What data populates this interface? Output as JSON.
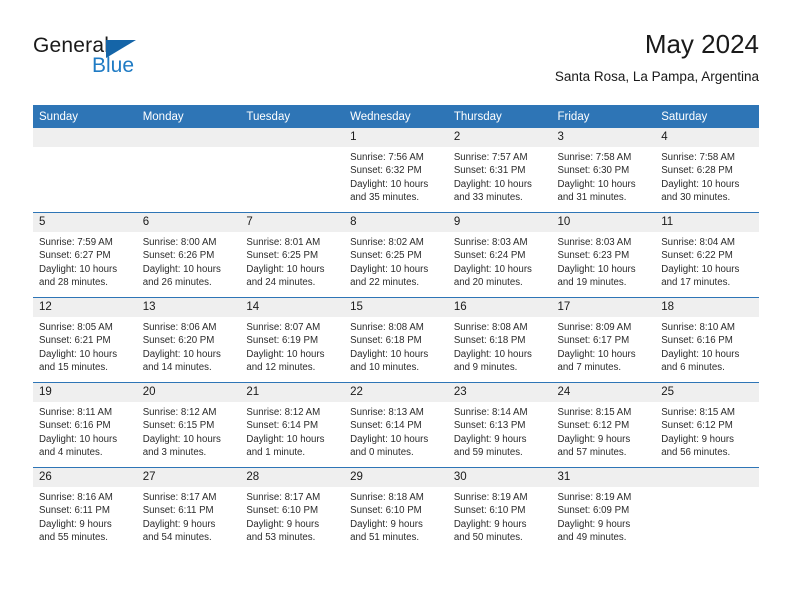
{
  "brand": {
    "name_top": "General",
    "name_bottom": "Blue",
    "color_dark": "#1a1a1a",
    "color_blue": "#1f7bc4",
    "triangle_color": "#1565a8"
  },
  "header": {
    "title": "May 2024",
    "subtitle": "Santa Rosa, La Pampa, Argentina"
  },
  "theme": {
    "header_bg": "#2e75b6",
    "header_text": "#ffffff",
    "daynum_bg": "#efefef",
    "row_divider": "#2e75b6",
    "cell_bg": "#ffffff"
  },
  "weekdays": [
    "Sunday",
    "Monday",
    "Tuesday",
    "Wednesday",
    "Thursday",
    "Friday",
    "Saturday"
  ],
  "labels": {
    "sunrise_prefix": "Sunrise:",
    "sunset_prefix": "Sunset:",
    "daylight_prefix": "Daylight:"
  },
  "weeks": [
    [
      {
        "day": "",
        "empty": true,
        "sunrise": "",
        "sunset": "",
        "daylight_1": "",
        "daylight_2": ""
      },
      {
        "day": "",
        "empty": true,
        "sunrise": "",
        "sunset": "",
        "daylight_1": "",
        "daylight_2": ""
      },
      {
        "day": "",
        "empty": true,
        "sunrise": "",
        "sunset": "",
        "daylight_1": "",
        "daylight_2": ""
      },
      {
        "day": "1",
        "empty": false,
        "sunrise": "Sunrise: 7:56 AM",
        "sunset": "Sunset: 6:32 PM",
        "daylight_1": "Daylight: 10 hours",
        "daylight_2": "and 35 minutes."
      },
      {
        "day": "2",
        "empty": false,
        "sunrise": "Sunrise: 7:57 AM",
        "sunset": "Sunset: 6:31 PM",
        "daylight_1": "Daylight: 10 hours",
        "daylight_2": "and 33 minutes."
      },
      {
        "day": "3",
        "empty": false,
        "sunrise": "Sunrise: 7:58 AM",
        "sunset": "Sunset: 6:30 PM",
        "daylight_1": "Daylight: 10 hours",
        "daylight_2": "and 31 minutes."
      },
      {
        "day": "4",
        "empty": false,
        "sunrise": "Sunrise: 7:58 AM",
        "sunset": "Sunset: 6:28 PM",
        "daylight_1": "Daylight: 10 hours",
        "daylight_2": "and 30 minutes."
      }
    ],
    [
      {
        "day": "5",
        "empty": false,
        "sunrise": "Sunrise: 7:59 AM",
        "sunset": "Sunset: 6:27 PM",
        "daylight_1": "Daylight: 10 hours",
        "daylight_2": "and 28 minutes."
      },
      {
        "day": "6",
        "empty": false,
        "sunrise": "Sunrise: 8:00 AM",
        "sunset": "Sunset: 6:26 PM",
        "daylight_1": "Daylight: 10 hours",
        "daylight_2": "and 26 minutes."
      },
      {
        "day": "7",
        "empty": false,
        "sunrise": "Sunrise: 8:01 AM",
        "sunset": "Sunset: 6:25 PM",
        "daylight_1": "Daylight: 10 hours",
        "daylight_2": "and 24 minutes."
      },
      {
        "day": "8",
        "empty": false,
        "sunrise": "Sunrise: 8:02 AM",
        "sunset": "Sunset: 6:25 PM",
        "daylight_1": "Daylight: 10 hours",
        "daylight_2": "and 22 minutes."
      },
      {
        "day": "9",
        "empty": false,
        "sunrise": "Sunrise: 8:03 AM",
        "sunset": "Sunset: 6:24 PM",
        "daylight_1": "Daylight: 10 hours",
        "daylight_2": "and 20 minutes."
      },
      {
        "day": "10",
        "empty": false,
        "sunrise": "Sunrise: 8:03 AM",
        "sunset": "Sunset: 6:23 PM",
        "daylight_1": "Daylight: 10 hours",
        "daylight_2": "and 19 minutes."
      },
      {
        "day": "11",
        "empty": false,
        "sunrise": "Sunrise: 8:04 AM",
        "sunset": "Sunset: 6:22 PM",
        "daylight_1": "Daylight: 10 hours",
        "daylight_2": "and 17 minutes."
      }
    ],
    [
      {
        "day": "12",
        "empty": false,
        "sunrise": "Sunrise: 8:05 AM",
        "sunset": "Sunset: 6:21 PM",
        "daylight_1": "Daylight: 10 hours",
        "daylight_2": "and 15 minutes."
      },
      {
        "day": "13",
        "empty": false,
        "sunrise": "Sunrise: 8:06 AM",
        "sunset": "Sunset: 6:20 PM",
        "daylight_1": "Daylight: 10 hours",
        "daylight_2": "and 14 minutes."
      },
      {
        "day": "14",
        "empty": false,
        "sunrise": "Sunrise: 8:07 AM",
        "sunset": "Sunset: 6:19 PM",
        "daylight_1": "Daylight: 10 hours",
        "daylight_2": "and 12 minutes."
      },
      {
        "day": "15",
        "empty": false,
        "sunrise": "Sunrise: 8:08 AM",
        "sunset": "Sunset: 6:18 PM",
        "daylight_1": "Daylight: 10 hours",
        "daylight_2": "and 10 minutes."
      },
      {
        "day": "16",
        "empty": false,
        "sunrise": "Sunrise: 8:08 AM",
        "sunset": "Sunset: 6:18 PM",
        "daylight_1": "Daylight: 10 hours",
        "daylight_2": "and 9 minutes."
      },
      {
        "day": "17",
        "empty": false,
        "sunrise": "Sunrise: 8:09 AM",
        "sunset": "Sunset: 6:17 PM",
        "daylight_1": "Daylight: 10 hours",
        "daylight_2": "and 7 minutes."
      },
      {
        "day": "18",
        "empty": false,
        "sunrise": "Sunrise: 8:10 AM",
        "sunset": "Sunset: 6:16 PM",
        "daylight_1": "Daylight: 10 hours",
        "daylight_2": "and 6 minutes."
      }
    ],
    [
      {
        "day": "19",
        "empty": false,
        "sunrise": "Sunrise: 8:11 AM",
        "sunset": "Sunset: 6:16 PM",
        "daylight_1": "Daylight: 10 hours",
        "daylight_2": "and 4 minutes."
      },
      {
        "day": "20",
        "empty": false,
        "sunrise": "Sunrise: 8:12 AM",
        "sunset": "Sunset: 6:15 PM",
        "daylight_1": "Daylight: 10 hours",
        "daylight_2": "and 3 minutes."
      },
      {
        "day": "21",
        "empty": false,
        "sunrise": "Sunrise: 8:12 AM",
        "sunset": "Sunset: 6:14 PM",
        "daylight_1": "Daylight: 10 hours",
        "daylight_2": "and 1 minute."
      },
      {
        "day": "22",
        "empty": false,
        "sunrise": "Sunrise: 8:13 AM",
        "sunset": "Sunset: 6:14 PM",
        "daylight_1": "Daylight: 10 hours",
        "daylight_2": "and 0 minutes."
      },
      {
        "day": "23",
        "empty": false,
        "sunrise": "Sunrise: 8:14 AM",
        "sunset": "Sunset: 6:13 PM",
        "daylight_1": "Daylight: 9 hours",
        "daylight_2": "and 59 minutes."
      },
      {
        "day": "24",
        "empty": false,
        "sunrise": "Sunrise: 8:15 AM",
        "sunset": "Sunset: 6:12 PM",
        "daylight_1": "Daylight: 9 hours",
        "daylight_2": "and 57 minutes."
      },
      {
        "day": "25",
        "empty": false,
        "sunrise": "Sunrise: 8:15 AM",
        "sunset": "Sunset: 6:12 PM",
        "daylight_1": "Daylight: 9 hours",
        "daylight_2": "and 56 minutes."
      }
    ],
    [
      {
        "day": "26",
        "empty": false,
        "sunrise": "Sunrise: 8:16 AM",
        "sunset": "Sunset: 6:11 PM",
        "daylight_1": "Daylight: 9 hours",
        "daylight_2": "and 55 minutes."
      },
      {
        "day": "27",
        "empty": false,
        "sunrise": "Sunrise: 8:17 AM",
        "sunset": "Sunset: 6:11 PM",
        "daylight_1": "Daylight: 9 hours",
        "daylight_2": "and 54 minutes."
      },
      {
        "day": "28",
        "empty": false,
        "sunrise": "Sunrise: 8:17 AM",
        "sunset": "Sunset: 6:10 PM",
        "daylight_1": "Daylight: 9 hours",
        "daylight_2": "and 53 minutes."
      },
      {
        "day": "29",
        "empty": false,
        "sunrise": "Sunrise: 8:18 AM",
        "sunset": "Sunset: 6:10 PM",
        "daylight_1": "Daylight: 9 hours",
        "daylight_2": "and 51 minutes."
      },
      {
        "day": "30",
        "empty": false,
        "sunrise": "Sunrise: 8:19 AM",
        "sunset": "Sunset: 6:10 PM",
        "daylight_1": "Daylight: 9 hours",
        "daylight_2": "and 50 minutes."
      },
      {
        "day": "31",
        "empty": false,
        "sunrise": "Sunrise: 8:19 AM",
        "sunset": "Sunset: 6:09 PM",
        "daylight_1": "Daylight: 9 hours",
        "daylight_2": "and 49 minutes."
      },
      {
        "day": "",
        "empty": true,
        "sunrise": "",
        "sunset": "",
        "daylight_1": "",
        "daylight_2": ""
      }
    ]
  ]
}
